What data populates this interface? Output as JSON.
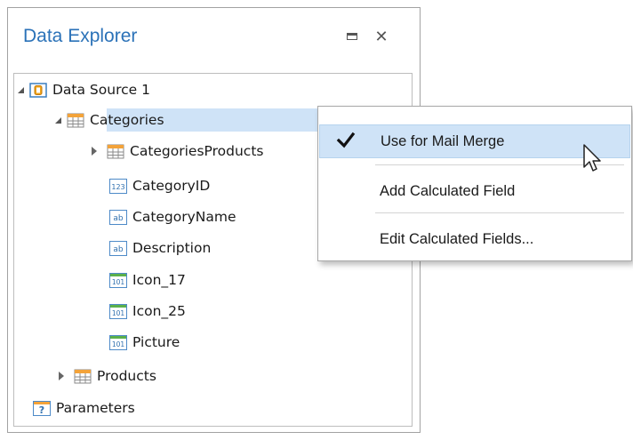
{
  "panel": {
    "title": "Data Explorer"
  },
  "tree": [
    {
      "label": "Data Source 1",
      "icon": "database-icon",
      "expander": "open"
    },
    {
      "label": "Categories",
      "icon": "table-icon",
      "expander": "open",
      "selected": true
    },
    {
      "label": "CategoriesProducts",
      "icon": "table-icon",
      "expander": "closed"
    },
    {
      "label": "CategoryID",
      "icon": "numeric-field-icon",
      "badge": "123"
    },
    {
      "label": "CategoryName",
      "icon": "string-field-icon",
      "badge": "ab"
    },
    {
      "label": "Description",
      "icon": "string-field-icon",
      "badge": "ab"
    },
    {
      "label": "Icon_17",
      "icon": "binary-field-icon",
      "badge": "101"
    },
    {
      "label": "Icon_25",
      "icon": "binary-field-icon",
      "badge": "101"
    },
    {
      "label": "Picture",
      "icon": "binary-field-icon",
      "badge": "101"
    },
    {
      "label": "Products",
      "icon": "table-icon",
      "expander": "closed"
    },
    {
      "label": "Parameters",
      "icon": "parameters-icon",
      "badge": "?"
    }
  ],
  "context_menu": {
    "items": [
      {
        "label": "Use for Mail Merge",
        "checked": true,
        "highlighted": true
      },
      {
        "label": "Add Calculated Field"
      },
      {
        "label": "Edit Calculated Fields..."
      }
    ]
  },
  "colors": {
    "title": "#2b72b8",
    "selection": "#cfe3f7"
  }
}
